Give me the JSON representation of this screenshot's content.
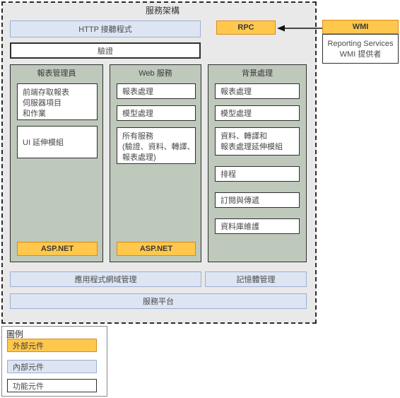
{
  "diagram": {
    "title": "服務架構",
    "top_layers": [
      {
        "label": "HTTP 接聽程式",
        "type": "internal"
      },
      {
        "label": "驗證",
        "type": "feature"
      }
    ],
    "rpc": {
      "label": "RPC",
      "type": "external"
    },
    "wmi": {
      "label": "WMI",
      "type": "external",
      "provider_label": "Reporting Services\nWMI 提供者",
      "provider_line1": "Reporting Services",
      "provider_line2": "WMI 提供者",
      "arrow_name": "wmi-to-rpc-arrow"
    },
    "columns": [
      {
        "title": "報表管理員",
        "items": [
          {
            "label": "前端存取報表\n伺服器項目\n和作業",
            "type": "feature",
            "lines": [
              "前端存取報表",
              "伺服器項目",
              "和作業"
            ]
          },
          {
            "label": "UI 延伸模組",
            "type": "feature",
            "lines": [
              "UI 延伸模組"
            ]
          }
        ],
        "footer": {
          "label": "ASP.NET",
          "type": "external"
        }
      },
      {
        "title": "Web 服務",
        "items": [
          {
            "label": "報表處理",
            "type": "feature",
            "lines": [
              "報表處理"
            ]
          },
          {
            "label": "模型處理",
            "type": "feature",
            "lines": [
              "模型處理"
            ]
          },
          {
            "label": "所有服務\n(驗證、資料、轉譯、\n報表處理)",
            "type": "feature",
            "lines": [
              "所有服務",
              "(驗證、資料、轉譯、",
              "報表處理)"
            ]
          }
        ],
        "footer": {
          "label": "ASP.NET",
          "type": "external"
        }
      },
      {
        "title": "背景處理",
        "items": [
          {
            "label": "報表處理",
            "type": "feature",
            "lines": [
              "報表處理"
            ]
          },
          {
            "label": "模型處理",
            "type": "feature",
            "lines": [
              "模型處理"
            ]
          },
          {
            "label": "資料、轉譯和\n報表處理延伸模組",
            "type": "feature",
            "lines": [
              "資料、轉譯和",
              "報表處理延伸模組"
            ]
          },
          {
            "label": "排程",
            "type": "feature",
            "lines": [
              "排程"
            ]
          },
          {
            "label": "訂閱與傳遞",
            "type": "feature",
            "lines": [
              "訂閱與傳遞"
            ]
          },
          {
            "label": "資料庫維護",
            "type": "feature",
            "lines": [
              "資料庫維護"
            ]
          }
        ],
        "footer": null
      }
    ],
    "bottom_layers": [
      {
        "label": "應用程式網域管理",
        "type": "internal"
      },
      {
        "label": "記憶體管理",
        "type": "internal"
      },
      {
        "label": "服務平台",
        "type": "internal"
      }
    ]
  },
  "legend": {
    "title": "圖例",
    "items": [
      {
        "label": "外部元件",
        "type": "external"
      },
      {
        "label": "內部元件",
        "type": "internal"
      },
      {
        "label": "功能元件",
        "type": "feature"
      }
    ]
  },
  "colors": {
    "external_fill": "#ffc84d",
    "external_border": "#d98b16",
    "internal_fill": "#dde5f3",
    "internal_border": "#9aafd2",
    "feature_fill": "#ffffff",
    "feature_border": "#2f2f2f",
    "group_panel_fill": "#bec8bb",
    "diagram_bg": "#e9e9e9",
    "dashed_border": "#2b2b2b"
  }
}
